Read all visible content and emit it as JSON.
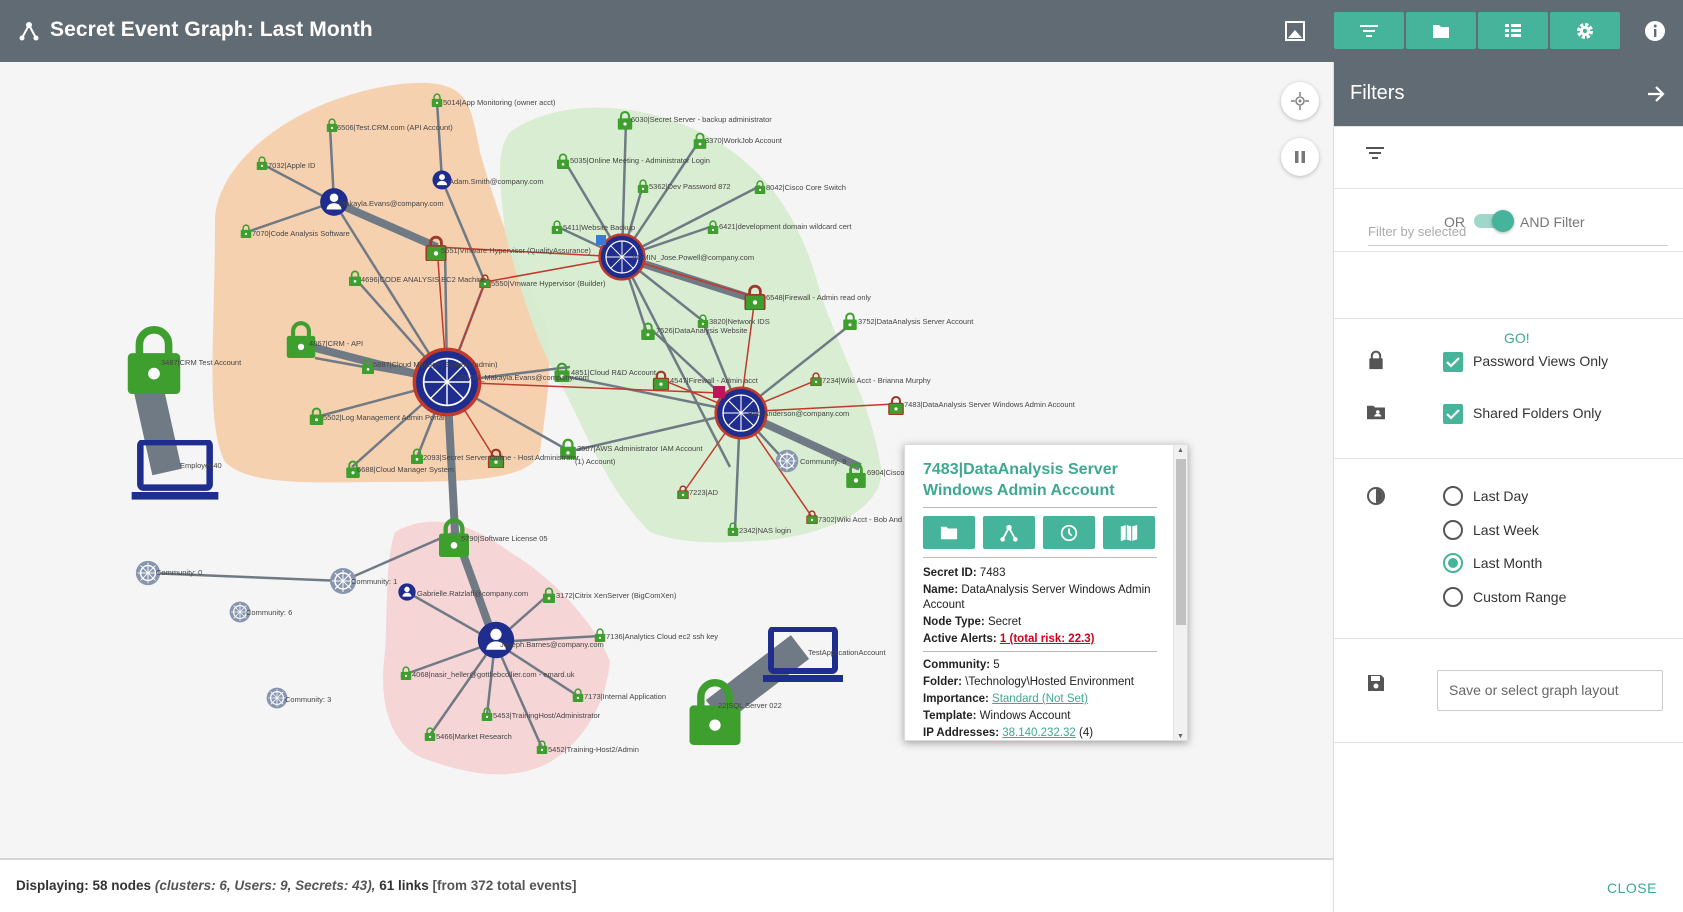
{
  "header": {
    "title": "Secret Event Graph: Last Month",
    "icons": [
      "graph-logo-icon",
      "image-export-icon",
      "info-icon"
    ],
    "toolbar": [
      "filter-icon",
      "folder-icon",
      "list-icon",
      "gear-icon"
    ]
  },
  "colors": {
    "header_bg": "#616b73",
    "accent": "#46b39b",
    "secret_node": "#3e9e2e",
    "user_node": "#1f2d8f",
    "alert_edge": "#c0392b",
    "cluster_orange": "#f6cda8",
    "cluster_green": "#d7ecd0",
    "cluster_pink": "#f5d3d4"
  },
  "graph": {
    "labels": {
      "n5014": "5014|App Monitoring (owner acct)",
      "n6506": "6506|Test.CRM.com (API Account)",
      "n7032": "7032|Apple ID",
      "adam": "Adam.Smith@company.com",
      "makayla": "Makayla.Evans@company.com",
      "n7070": "7070|Code Analysis Software",
      "n5551": "5551|Vmware Hypervisor (QualityAssurance)",
      "n4696": "4696|CODE ANALYSIS EC2 Machine",
      "n5550": "5550|Vmware Hypervisor (Builder)",
      "n4867": "4867|CRM - API",
      "n5887": "5887|Cloud Manager System (admin)",
      "admin_makayla": "ADMIN_Makayla.Evans@company.com",
      "n3487": "3487|CRM Test Account",
      "n5502": "5502|Log Management Admin Portal",
      "n2093": "2093|Secret Server Online - Host Administrator",
      "n6688": "6688|Cloud Manager System",
      "employee40": "Employee40",
      "n6030": "6030|Secret Server - backup administrator",
      "n3370": "3370|WorkJob Account",
      "n5035": "5035|Online Meeting - Administrator Login",
      "n5362": "5362|Dev Password 872",
      "n8042": "8042|Cisco Core Switch",
      "n5411": "5411|Website Backup",
      "n6421": "6421|development domain wildcard cert",
      "admin_jose": "ADMIN_Jose.Powell@company.com",
      "n6548": "6548|Firewall - Admin read only",
      "n3820": "3820|Network IDS",
      "n7526": "7526|DataAnalysis Website",
      "n3752": "3752|DataAnalysis Server Account",
      "n4851": "4851|Cloud R&D Account",
      "n4547": "4547|Firewall - Admin acct",
      "n7234": "7234|Wiki Acct - Brianna Murphy",
      "n7483": "7483|DataAnalysis Server Windows Admin Account",
      "bob": "Bob.Anderson@company.com",
      "n3507": "3507|AWS Administrator IAM Account",
      "n9a": "(1) Account)",
      "community9": "Community: 9",
      "n6904": "6904|Cisco",
      "n7223": "7223|AD",
      "n7302": "7302|Wiki Acct - Bob And",
      "n2342": "2342|NAS login",
      "n5790": "5790|Software License 05",
      "community0": "Community: 0",
      "community1": "Community: 1",
      "community6": "Community: 6",
      "community3": "Community: 3",
      "gabrielle": "Gabrielle.Ratzlaff@company.com",
      "n3172": "3172|Citrix XenServer (BigComXen)",
      "n7136": "7136|Analytics Cloud ec2 ssh key",
      "joseph": "Joseph.Barnes@company.com",
      "n4068": "4068|nasir_heller@gottliebcollier.com - emard.uk",
      "n7173": "7173|Internal Application",
      "n5453": "5453|TrainingHost/Administrator",
      "n5466": "5466|Market Research",
      "n5452": "5452|Training-Host2/Admin",
      "testapp": "TestApplicationAccount",
      "n22": "22|SQL Server 022"
    },
    "controls": [
      "center-graph-icon",
      "pause-icon"
    ]
  },
  "popup": {
    "title": "7483|DataAnalysis Server Windows Admin Account",
    "actions": [
      "folder-icon",
      "graph-icon",
      "history-icon",
      "map-icon"
    ],
    "fields": {
      "secret_id_label": "Secret ID:",
      "secret_id": "7483",
      "name_label": "Name:",
      "name": "DataAnalysis Server Windows Admin Account",
      "node_type_label": "Node Type:",
      "node_type": "Secret",
      "alerts_label": "Active Alerts:",
      "alerts": "1 (total risk: 22.3)",
      "community_label": "Community:",
      "community": "5",
      "folder_label": "Folder:",
      "folder": "\\Technology\\Hosted Environment",
      "importance_label": "Importance:",
      "importance": "Standard (Not Set)",
      "template_label": "Template:",
      "template": "Windows Account",
      "ip_label": "IP Addresses:",
      "ip": "38.140.232.32",
      "ip_count": "(4)"
    }
  },
  "status": {
    "prefix": "Displaying:",
    "nodes": "58 nodes",
    "detail": "(clusters: 6, Users: 9, Secrets: 43),",
    "links": "61 links",
    "total": "[from 372 total events]"
  },
  "sidebar": {
    "title": "Filters",
    "or_label": "OR",
    "and_label": "AND Filter",
    "filter_placeholder": "Filter by selected",
    "go_label": "GO!",
    "password_views": "Password Views Only",
    "shared_folders": "Shared Folders Only",
    "range_options": [
      "Last Day",
      "Last Week",
      "Last Month",
      "Custom Range"
    ],
    "range_selected": "Last Month",
    "layout_placeholder": "Save or select graph layout",
    "close_label": "CLOSE"
  }
}
